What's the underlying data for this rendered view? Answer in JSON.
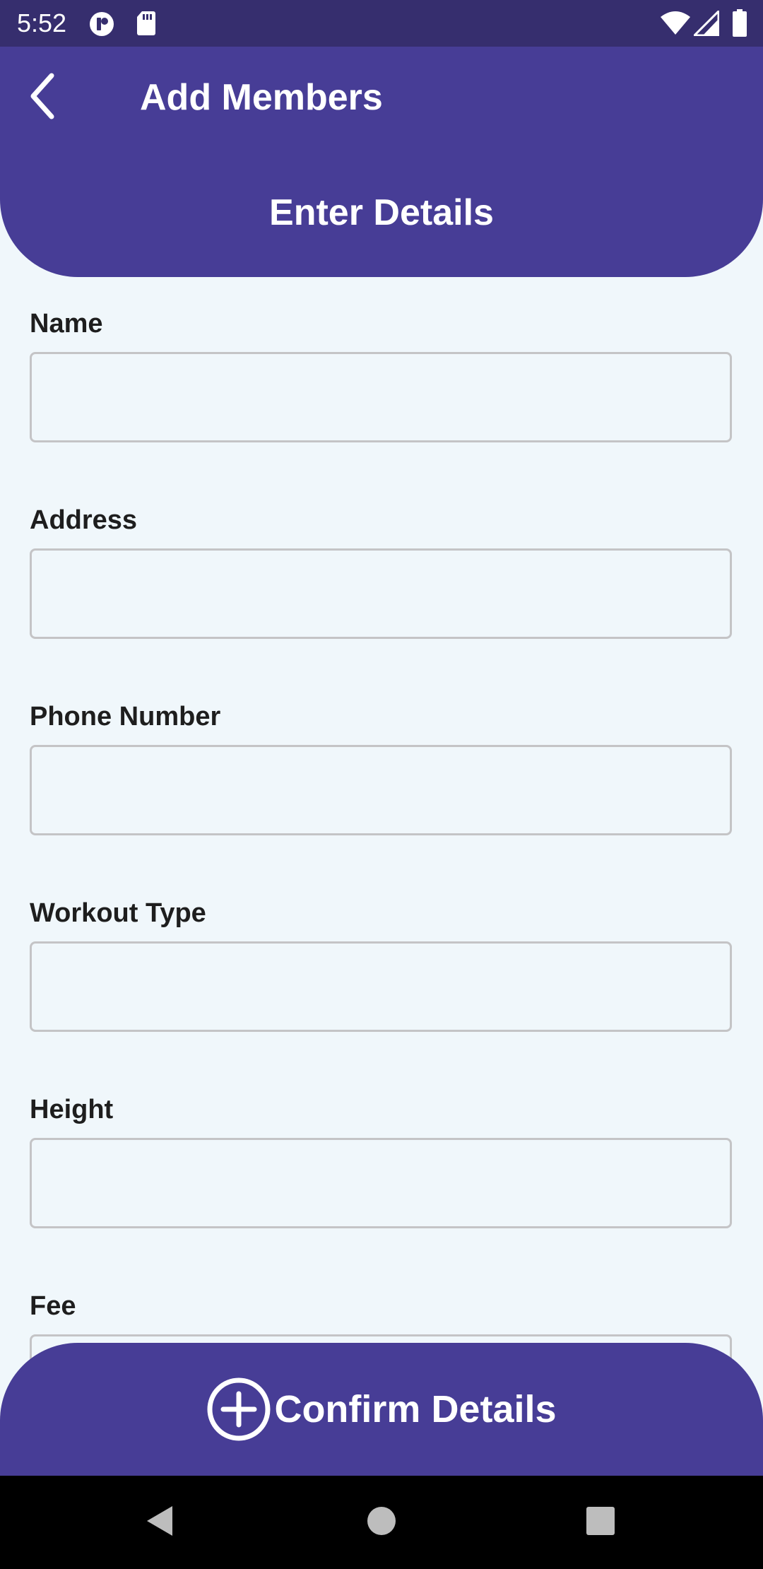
{
  "status_bar": {
    "time": "5:52",
    "left_icons": [
      "notification-app-icon",
      "sd-card-icon"
    ],
    "right_icons": [
      "wifi-icon",
      "cell-signal-icon",
      "battery-icon"
    ]
  },
  "header": {
    "title": "Add Members",
    "section_title": "Enter Details",
    "back_icon": "chevron-left-icon"
  },
  "form": {
    "fields": [
      {
        "label": "Name",
        "value": "",
        "placeholder": ""
      },
      {
        "label": "Address",
        "value": "",
        "placeholder": ""
      },
      {
        "label": "Phone Number",
        "value": "",
        "placeholder": ""
      },
      {
        "label": "Workout Type",
        "value": "",
        "placeholder": ""
      },
      {
        "label": "Height",
        "value": "",
        "placeholder": ""
      },
      {
        "label": "Fee",
        "value": "",
        "placeholder": ""
      }
    ]
  },
  "confirm_button": {
    "label": "Confirm Details",
    "icon": "add-circle-icon"
  },
  "nav_bar": {
    "icons": [
      "back-triangle-icon",
      "home-circle-icon",
      "recents-square-icon"
    ]
  },
  "colors": {
    "status_bar": "#362E6E",
    "primary": "#473D96",
    "background": "#F0F7FB",
    "input_border": "#C4C4C6",
    "label_text": "#1E1E1E"
  }
}
